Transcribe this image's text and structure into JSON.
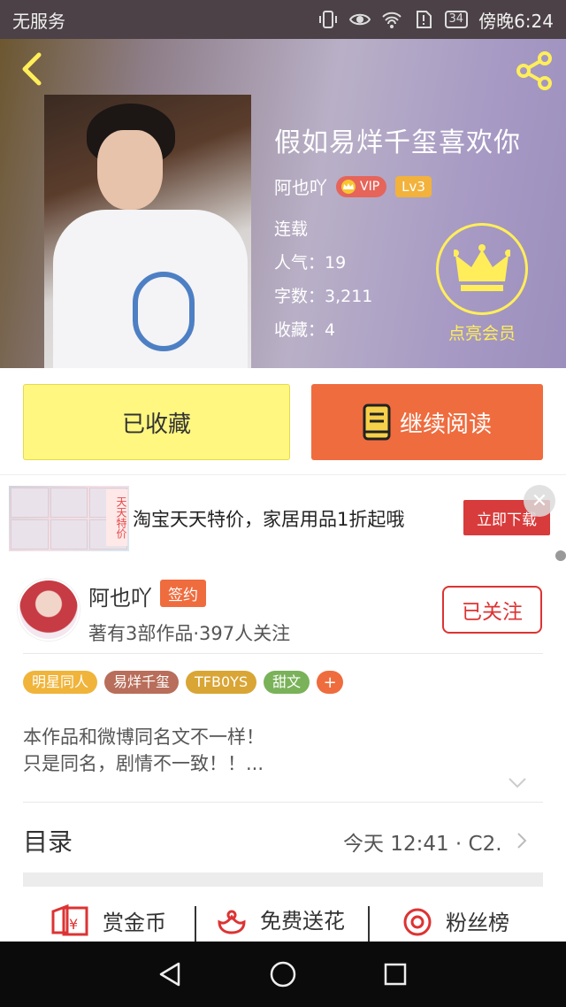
{
  "status_bar": {
    "carrier": "无服务",
    "battery": "34",
    "time": "傍晚6:24"
  },
  "book": {
    "title": "假如易烊千玺喜欢你",
    "author": "阿也吖",
    "vip_label": "VIP",
    "level": "Lv3",
    "status": "连载",
    "popularity": "人气：19",
    "word_count": "字数：3,211",
    "favorites": "收藏：4",
    "member_label": "点亮会员"
  },
  "actions": {
    "collected_label": "已收藏",
    "continue_label": "继续阅读"
  },
  "ad": {
    "tag": "天天特价",
    "text": "淘宝天天特价，家居用品1折起哦",
    "button": "立即下载",
    "close": "✕"
  },
  "author": {
    "name": "阿也吖",
    "sign_badge": "签约",
    "meta": "著有3部作品·397人关注",
    "follow_label": "已关注"
  },
  "tags": [
    {
      "label": "明星同人",
      "color": "#f0b43a"
    },
    {
      "label": "易烊千玺",
      "color": "#b86e5a"
    },
    {
      "label": "TFB0YS",
      "color": "#d9a535"
    },
    {
      "label": "甜文",
      "color": "#7ab25a"
    }
  ],
  "tag_add": "+",
  "description": {
    "line1": "本作品和微博同名文不一样！",
    "line2": "只是同名，剧情不一致！！..."
  },
  "toc": {
    "label": "目录",
    "update": "今天 12:41 · C2."
  },
  "bottom_actions": {
    "reward": "赏金币",
    "flower": "免费送花",
    "fans": "粉丝榜"
  },
  "colors": {
    "accent_orange": "#ef6c3e",
    "collected_yellow": "#fff780",
    "member_yellow": "#ffee5a",
    "follow_red": "#dd3333"
  }
}
